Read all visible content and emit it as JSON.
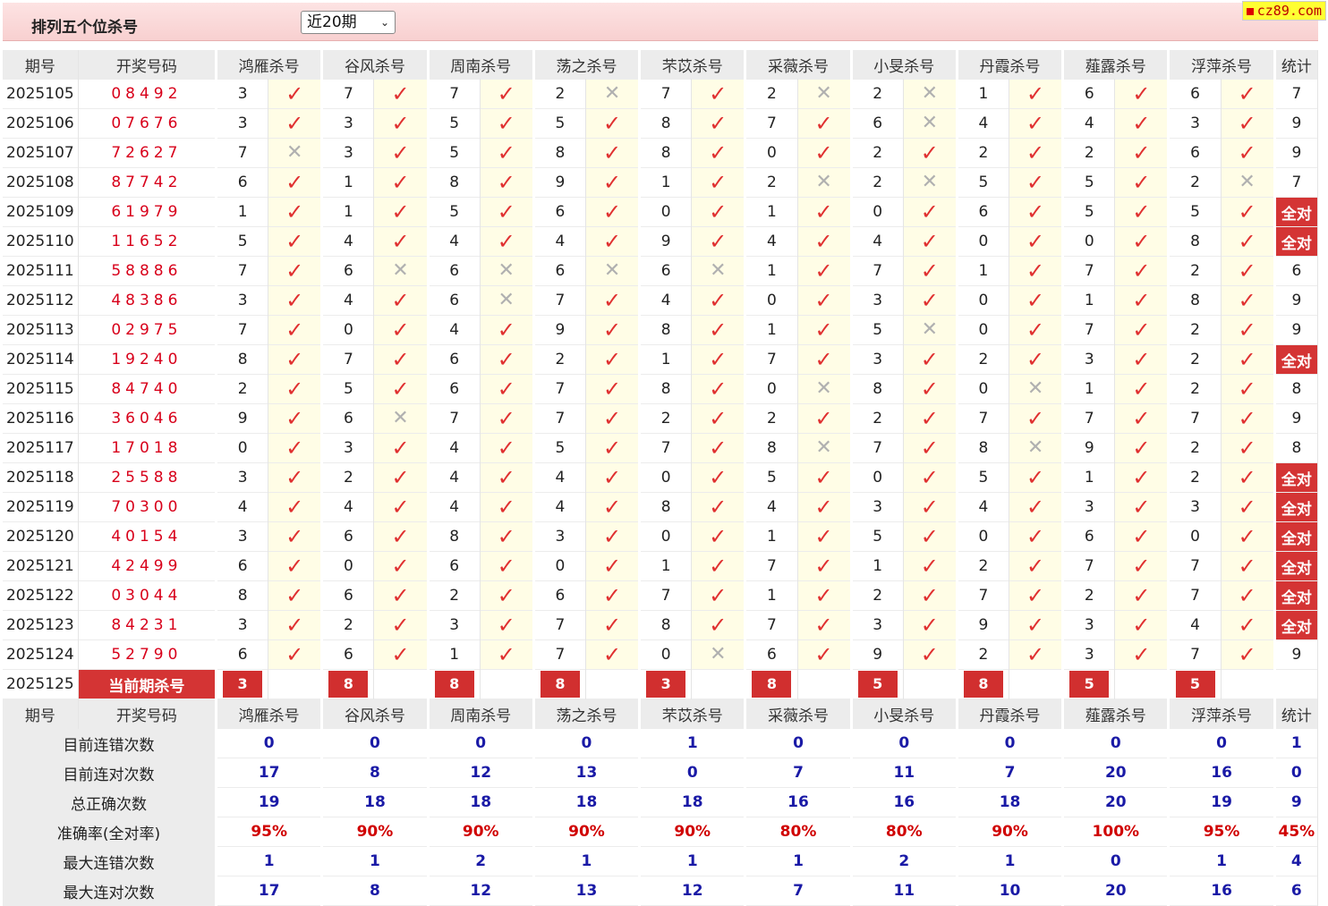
{
  "header": {
    "title": "排列五个位杀号",
    "range_select": "近20期",
    "watermark": "cz89.com"
  },
  "columns": {
    "period": "期号",
    "draw": "开奖号码",
    "methods": [
      "鸿雁杀号",
      "谷风杀号",
      "周南杀号",
      "荡之杀号",
      "芣苡杀号",
      "采薇杀号",
      "小旻杀号",
      "丹霞杀号",
      "薤露杀号",
      "浮萍杀号"
    ],
    "total": "统计"
  },
  "rows": [
    {
      "period": "2025105",
      "draw": "08492",
      "picks": [
        3,
        7,
        7,
        2,
        7,
        2,
        2,
        1,
        6,
        6
      ],
      "hits": [
        1,
        1,
        1,
        0,
        1,
        0,
        0,
        1,
        1,
        1
      ],
      "total": "7"
    },
    {
      "period": "2025106",
      "draw": "07676",
      "picks": [
        3,
        3,
        5,
        5,
        8,
        7,
        6,
        4,
        4,
        3
      ],
      "hits": [
        1,
        1,
        1,
        1,
        1,
        1,
        0,
        1,
        1,
        1
      ],
      "total": "9"
    },
    {
      "period": "2025107",
      "draw": "72627",
      "picks": [
        7,
        3,
        5,
        8,
        8,
        0,
        2,
        2,
        2,
        6
      ],
      "hits": [
        0,
        1,
        1,
        1,
        1,
        1,
        1,
        1,
        1,
        1
      ],
      "total": "9"
    },
    {
      "period": "2025108",
      "draw": "87742",
      "picks": [
        6,
        1,
        8,
        9,
        1,
        2,
        2,
        5,
        5,
        2
      ],
      "hits": [
        1,
        1,
        1,
        1,
        1,
        0,
        0,
        1,
        1,
        0
      ],
      "total": "7"
    },
    {
      "period": "2025109",
      "draw": "61979",
      "picks": [
        1,
        1,
        5,
        6,
        0,
        1,
        0,
        6,
        5,
        5
      ],
      "hits": [
        1,
        1,
        1,
        1,
        1,
        1,
        1,
        1,
        1,
        1
      ],
      "total": "全对"
    },
    {
      "period": "2025110",
      "draw": "11652",
      "picks": [
        5,
        4,
        4,
        4,
        9,
        4,
        4,
        0,
        0,
        8
      ],
      "hits": [
        1,
        1,
        1,
        1,
        1,
        1,
        1,
        1,
        1,
        1
      ],
      "total": "全对"
    },
    {
      "period": "2025111",
      "draw": "58886",
      "picks": [
        7,
        6,
        6,
        6,
        6,
        1,
        7,
        1,
        7,
        2
      ],
      "hits": [
        1,
        0,
        0,
        0,
        0,
        1,
        1,
        1,
        1,
        1
      ],
      "total": "6"
    },
    {
      "period": "2025112",
      "draw": "48386",
      "picks": [
        3,
        4,
        6,
        7,
        4,
        0,
        3,
        0,
        1,
        8
      ],
      "hits": [
        1,
        1,
        0,
        1,
        1,
        1,
        1,
        1,
        1,
        1
      ],
      "total": "9"
    },
    {
      "period": "2025113",
      "draw": "02975",
      "picks": [
        7,
        0,
        4,
        9,
        8,
        1,
        5,
        0,
        7,
        2
      ],
      "hits": [
        1,
        1,
        1,
        1,
        1,
        1,
        0,
        1,
        1,
        1
      ],
      "total": "9"
    },
    {
      "period": "2025114",
      "draw": "19240",
      "picks": [
        8,
        7,
        6,
        2,
        1,
        7,
        3,
        2,
        3,
        2
      ],
      "hits": [
        1,
        1,
        1,
        1,
        1,
        1,
        1,
        1,
        1,
        1
      ],
      "total": "全对"
    },
    {
      "period": "2025115",
      "draw": "84740",
      "picks": [
        2,
        5,
        6,
        7,
        8,
        0,
        8,
        0,
        1,
        2
      ],
      "hits": [
        1,
        1,
        1,
        1,
        1,
        0,
        1,
        0,
        1,
        1
      ],
      "total": "8"
    },
    {
      "period": "2025116",
      "draw": "36046",
      "picks": [
        9,
        6,
        7,
        7,
        2,
        2,
        2,
        7,
        7,
        7
      ],
      "hits": [
        1,
        0,
        1,
        1,
        1,
        1,
        1,
        1,
        1,
        1
      ],
      "total": "9"
    },
    {
      "period": "2025117",
      "draw": "17018",
      "picks": [
        0,
        3,
        4,
        5,
        7,
        8,
        7,
        8,
        9,
        2
      ],
      "hits": [
        1,
        1,
        1,
        1,
        1,
        0,
        1,
        0,
        1,
        1
      ],
      "total": "8"
    },
    {
      "period": "2025118",
      "draw": "25588",
      "picks": [
        3,
        2,
        4,
        4,
        0,
        5,
        0,
        5,
        1,
        2
      ],
      "hits": [
        1,
        1,
        1,
        1,
        1,
        1,
        1,
        1,
        1,
        1
      ],
      "total": "全对"
    },
    {
      "period": "2025119",
      "draw": "70300",
      "picks": [
        4,
        4,
        4,
        4,
        8,
        4,
        3,
        4,
        3,
        3
      ],
      "hits": [
        1,
        1,
        1,
        1,
        1,
        1,
        1,
        1,
        1,
        1
      ],
      "total": "全对"
    },
    {
      "period": "2025120",
      "draw": "40154",
      "picks": [
        3,
        6,
        8,
        3,
        0,
        1,
        5,
        0,
        6,
        0
      ],
      "hits": [
        1,
        1,
        1,
        1,
        1,
        1,
        1,
        1,
        1,
        1
      ],
      "total": "全对"
    },
    {
      "period": "2025121",
      "draw": "42499",
      "picks": [
        6,
        0,
        6,
        0,
        1,
        7,
        1,
        2,
        7,
        7
      ],
      "hits": [
        1,
        1,
        1,
        1,
        1,
        1,
        1,
        1,
        1,
        1
      ],
      "total": "全对"
    },
    {
      "period": "2025122",
      "draw": "03044",
      "picks": [
        8,
        6,
        2,
        6,
        7,
        1,
        2,
        7,
        2,
        7
      ],
      "hits": [
        1,
        1,
        1,
        1,
        1,
        1,
        1,
        1,
        1,
        1
      ],
      "total": "全对"
    },
    {
      "period": "2025123",
      "draw": "84231",
      "picks": [
        3,
        2,
        3,
        7,
        8,
        7,
        3,
        9,
        3,
        4
      ],
      "hits": [
        1,
        1,
        1,
        1,
        1,
        1,
        1,
        1,
        1,
        1
      ],
      "total": "全对"
    },
    {
      "period": "2025124",
      "draw": "52790",
      "picks": [
        6,
        6,
        1,
        7,
        0,
        6,
        9,
        2,
        3,
        7
      ],
      "hits": [
        1,
        1,
        1,
        1,
        0,
        1,
        1,
        1,
        1,
        1
      ],
      "total": "9"
    }
  ],
  "current": {
    "period": "2025125",
    "label": "当前期杀号",
    "picks": [
      3,
      8,
      8,
      8,
      3,
      8,
      5,
      8,
      5,
      5
    ]
  },
  "stats": [
    {
      "label": "目前连错次数",
      "values": [
        "0",
        "0",
        "0",
        "0",
        "1",
        "0",
        "0",
        "0",
        "0",
        "0"
      ],
      "total": "1",
      "color": "blue"
    },
    {
      "label": "目前连对次数",
      "values": [
        "17",
        "8",
        "12",
        "13",
        "0",
        "7",
        "11",
        "7",
        "20",
        "16"
      ],
      "total": "0",
      "color": "blue"
    },
    {
      "label": "总正确次数",
      "values": [
        "19",
        "18",
        "18",
        "18",
        "18",
        "16",
        "16",
        "18",
        "20",
        "19"
      ],
      "total": "9",
      "color": "blue"
    },
    {
      "label": "准确率(全对率)",
      "values": [
        "95%",
        "90%",
        "90%",
        "90%",
        "90%",
        "80%",
        "80%",
        "90%",
        "100%",
        "95%"
      ],
      "total": "45%",
      "color": "red"
    },
    {
      "label": "最大连错次数",
      "values": [
        "1",
        "1",
        "2",
        "1",
        "1",
        "1",
        "2",
        "1",
        "0",
        "1"
      ],
      "total": "4",
      "color": "blue"
    },
    {
      "label": "最大连对次数",
      "values": [
        "17",
        "8",
        "12",
        "13",
        "12",
        "7",
        "11",
        "10",
        "20",
        "16"
      ],
      "total": "6",
      "color": "blue"
    }
  ],
  "icons": {
    "hit": "check-icon",
    "miss": "cross-icon"
  },
  "colors": {
    "accent_red": "#d43434",
    "draw_red": "#d8001a",
    "stat_blue": "#1a1aa6",
    "highlight": "#fffde6"
  }
}
